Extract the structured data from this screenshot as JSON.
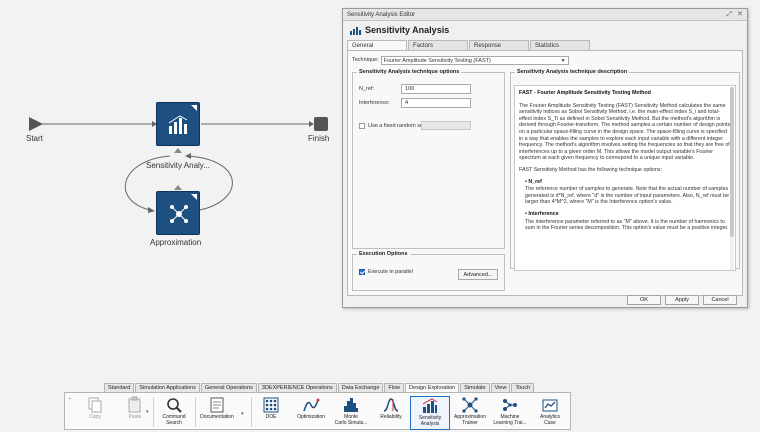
{
  "canvas": {
    "nodes": {
      "start": "Start",
      "finish": "Finish",
      "sensitivity": "Sensitivity Analy...",
      "approximation": "Approximation"
    }
  },
  "dialog": {
    "window_title": "Sensitivity Analysis Editor",
    "title": "Sensitivity Analysis",
    "tabs": [
      "General",
      "Factors",
      "Response",
      "Statistics"
    ],
    "technique_label": "Technique:",
    "technique_value": "Fourier Amplitude Sensitivity Testing (FAST)",
    "options_group": "Sensitivity Analysis technique options",
    "params": {
      "nref_label": "N_ref:",
      "nref_value": "100",
      "interference_label": "Interference:",
      "interference_value": "4"
    },
    "seed_label": "Use a fixed random seed:",
    "description_group": "Sensitivity Analysis technique description",
    "description": {
      "title": "FAST - Fourier Amplitude Sensitivity Testing Method",
      "p1": "The Fourier Amplitude Sensitivity Testing (FAST) Sensitivity Method calculates the same sensitivity indices as Sobol Sensitivity Method, i.e. the main-effect index S_i and total-effect index S_Ti as defined in Sobol Sensitivity Method. But the method's algorithm is derived through Fourier-transform. The method samples a certain number of design points on a particular space-filling curve in the design space. The space-filling curve is specified in a way that enables the samples to explore each input variable with a different integer frequency. The method's algorithm involves setting the frequencies so that they are free of interferences up to a given order M. This allows the model output variable's Fourier spectrum at each given frequency to correspond to a unique input variable.",
      "p2": "FAST Sensitivity Method has the following technique options:",
      "nref_head": "• N_ref",
      "nref_text": "The reference number of samples to generate. Note that the actual number of samples generated is d*N_ref, where \"d\" is the number of input parameters. Also, N_ref must be larger than 4*M^2, where \"M\" is the Interference option's value.",
      "interf_head": "• Interference",
      "interf_text": "The interference parameter referred to as \"M\" above. It is the number of harmonics to sum in the Fourier series decomposition. This option's value must be a positive integer."
    },
    "exec_group": "Execution Options",
    "exec_parallel_label": "Execute in parallel",
    "advanced_label": "Advanced...",
    "buttons": {
      "ok": "OK",
      "apply": "Apply",
      "cancel": "Cancel"
    }
  },
  "toolbar": {
    "tabs": [
      "Standard",
      "Simulation Applications",
      "General Operations",
      "3DEXPERIENCE Operations",
      "Data Exchange",
      "Flow",
      "Design Exploration",
      "Simulate",
      "View",
      "Touch"
    ],
    "active_tab": "Design Exploration",
    "tools": {
      "copy": "Copy",
      "paste": "Paste",
      "command_search_1": "Command",
      "command_search_2": "Search",
      "documentation": "Documentation",
      "doe": "DOE",
      "optimization": "Optimization",
      "monte_1": "Monte",
      "monte_2": "Carlo Simula...",
      "reliability": "Reliability",
      "sensitivity_1": "Sensitivity",
      "sensitivity_2": "Analysis",
      "approx_1": "Approximation",
      "approx_2": "Trainer",
      "ml_1": "Machine",
      "ml_2": "Learning Trai...",
      "analytics_1": "Analytics",
      "analytics_2": "Case"
    }
  },
  "colors": {
    "node_fill": "#1d4f80",
    "accent": "#1f6ec4",
    "edge": "#555555"
  }
}
